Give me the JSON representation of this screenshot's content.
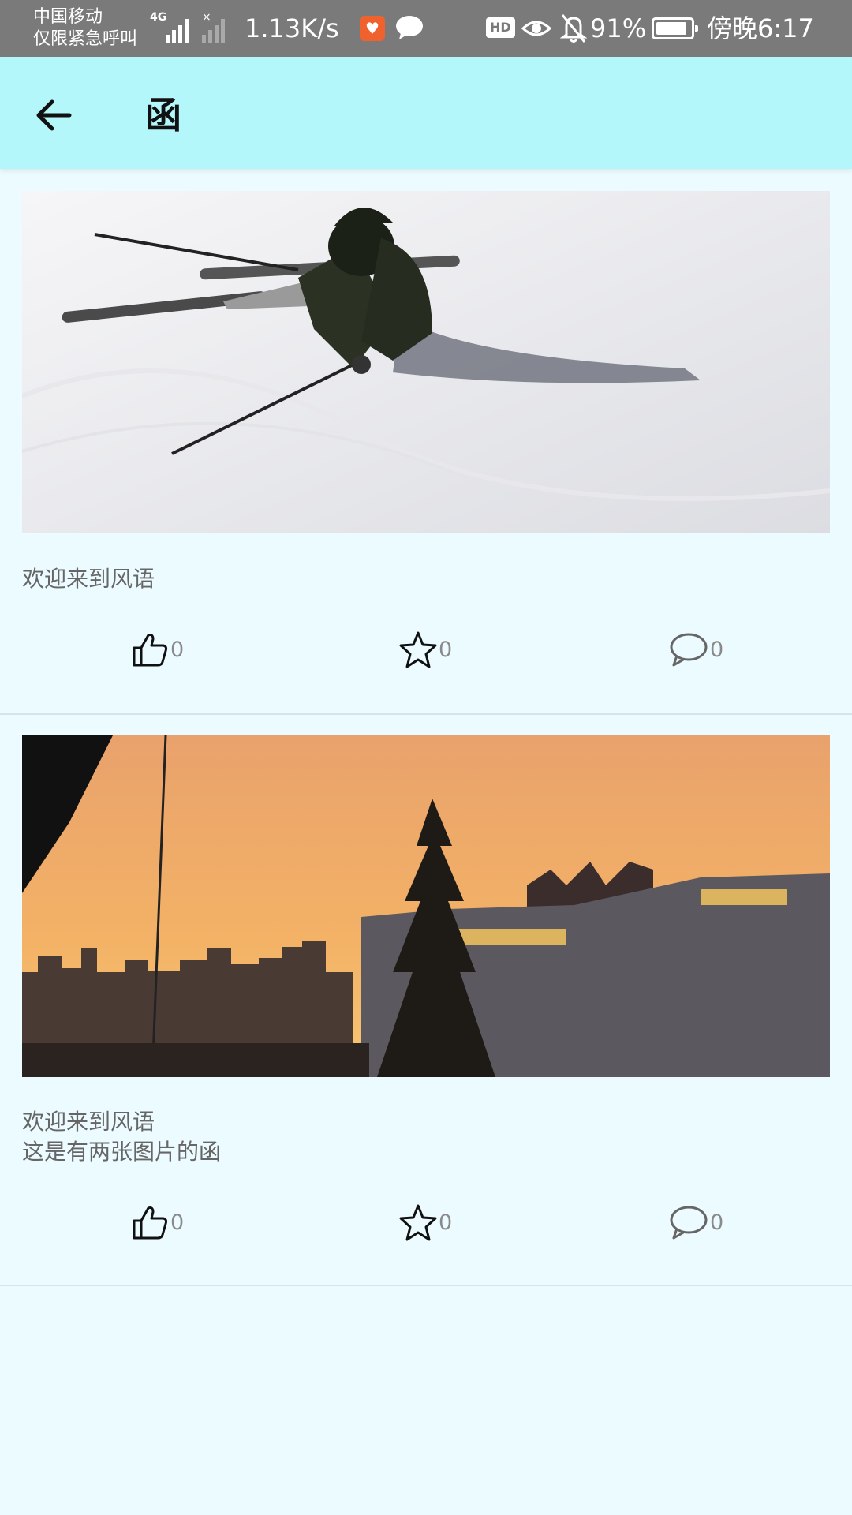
{
  "status_bar": {
    "carrier_line1": "中国移动",
    "carrier_line2": "仅限紧急呼叫",
    "network_type": "4G",
    "net_speed": "1.13K/s",
    "hd_label": "HD",
    "battery_percent": "91%",
    "battery_level": 0.91,
    "time": "傍晚6:17",
    "icons": [
      "signal-icon",
      "signal-off-icon",
      "app-notification-icon",
      "chat-icon",
      "eye-icon",
      "bell-off-icon",
      "battery-icon"
    ]
  },
  "app_bar": {
    "title": "函",
    "back_icon": "arrow-left-icon",
    "background": "#b3f7fb"
  },
  "posts": [
    {
      "image": "ski-photo",
      "text_lines": [
        "欢迎来到风语"
      ],
      "likes": "0",
      "favorites": "0",
      "comments": "0"
    },
    {
      "image": "sunset-photo",
      "text_lines": [
        "欢迎来到风语",
        "这是有两张图片的函"
      ],
      "likes": "0",
      "favorites": "0",
      "comments": "0"
    }
  ],
  "colors": {
    "page_background": "#ecfbff",
    "status_bar": "#7a7a7a",
    "text_secondary": "#666666"
  }
}
